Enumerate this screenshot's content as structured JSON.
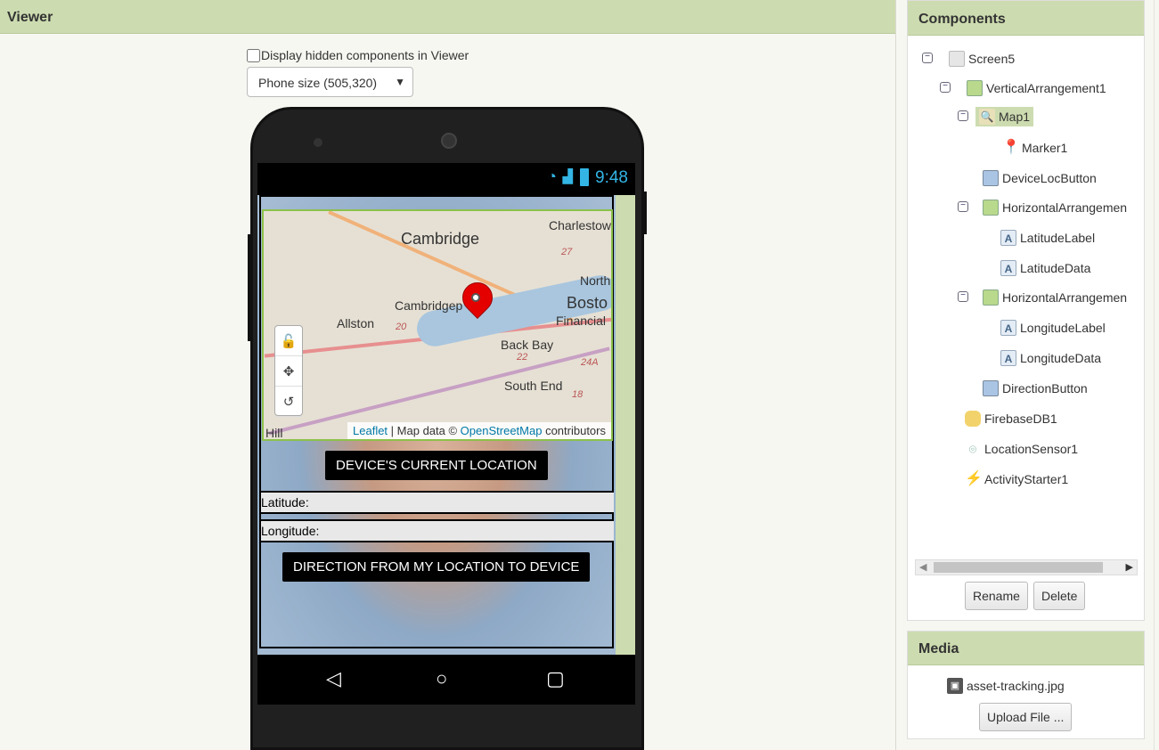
{
  "viewer": {
    "title": "Viewer",
    "hidden_checkbox_label": "Display hidden components in Viewer",
    "size_select": "Phone size (505,320)"
  },
  "phone": {
    "time": "9:48",
    "map": {
      "labels": [
        "Cambridge",
        "Charlestow",
        "North",
        "Bosto",
        "Cambridgep",
        "Financial",
        "Allston",
        "Back Bay",
        "South End",
        "Hill",
        "20",
        "27",
        "22",
        "24A",
        "18"
      ],
      "attribution_leaflet": "Leaflet",
      "attribution_mid": " | Map data © ",
      "attribution_osm": "OpenStreetMap",
      "attribution_end": " contributors"
    },
    "device_location_button": "DEVICE'S CURRENT LOCATION",
    "latitude_label": "Latitude:",
    "longitude_label": "Longitude:",
    "direction_button": "DIRECTION FROM MY LOCATION TO DEVICE"
  },
  "components": {
    "title": "Components",
    "tree": [
      {
        "label": "Screen5",
        "icon": "screen-icon"
      },
      {
        "label": "VerticalArrangement1",
        "icon": "vertical-arrangement-icon"
      },
      {
        "label": "Map1",
        "icon": "map-icon"
      },
      {
        "label": "Marker1",
        "icon": "marker-icon"
      },
      {
        "label": "DeviceLocButton",
        "icon": "button-icon"
      },
      {
        "label": "HorizontalArrangemen",
        "icon": "horizontal-arrangement-icon"
      },
      {
        "label": "LatitudeLabel",
        "icon": "label-icon"
      },
      {
        "label": "LatitudeData",
        "icon": "label-icon"
      },
      {
        "label": "HorizontalArrangemen",
        "icon": "horizontal-arrangement-icon"
      },
      {
        "label": "LongitudeLabel",
        "icon": "label-icon"
      },
      {
        "label": "LongitudeData",
        "icon": "label-icon"
      },
      {
        "label": "DirectionButton",
        "icon": "button-icon"
      },
      {
        "label": "FirebaseDB1",
        "icon": "database-icon"
      },
      {
        "label": "LocationSensor1",
        "icon": "location-sensor-icon"
      },
      {
        "label": "ActivityStarter1",
        "icon": "activity-starter-icon"
      }
    ],
    "rename_button": "Rename",
    "delete_button": "Delete"
  },
  "media": {
    "title": "Media",
    "asset": "asset-tracking.jpg",
    "upload_button": "Upload File ..."
  },
  "colors": {
    "header_bg": "#cddcb0",
    "accent_blue": "#33b5e5",
    "marker_red": "#e50000"
  }
}
